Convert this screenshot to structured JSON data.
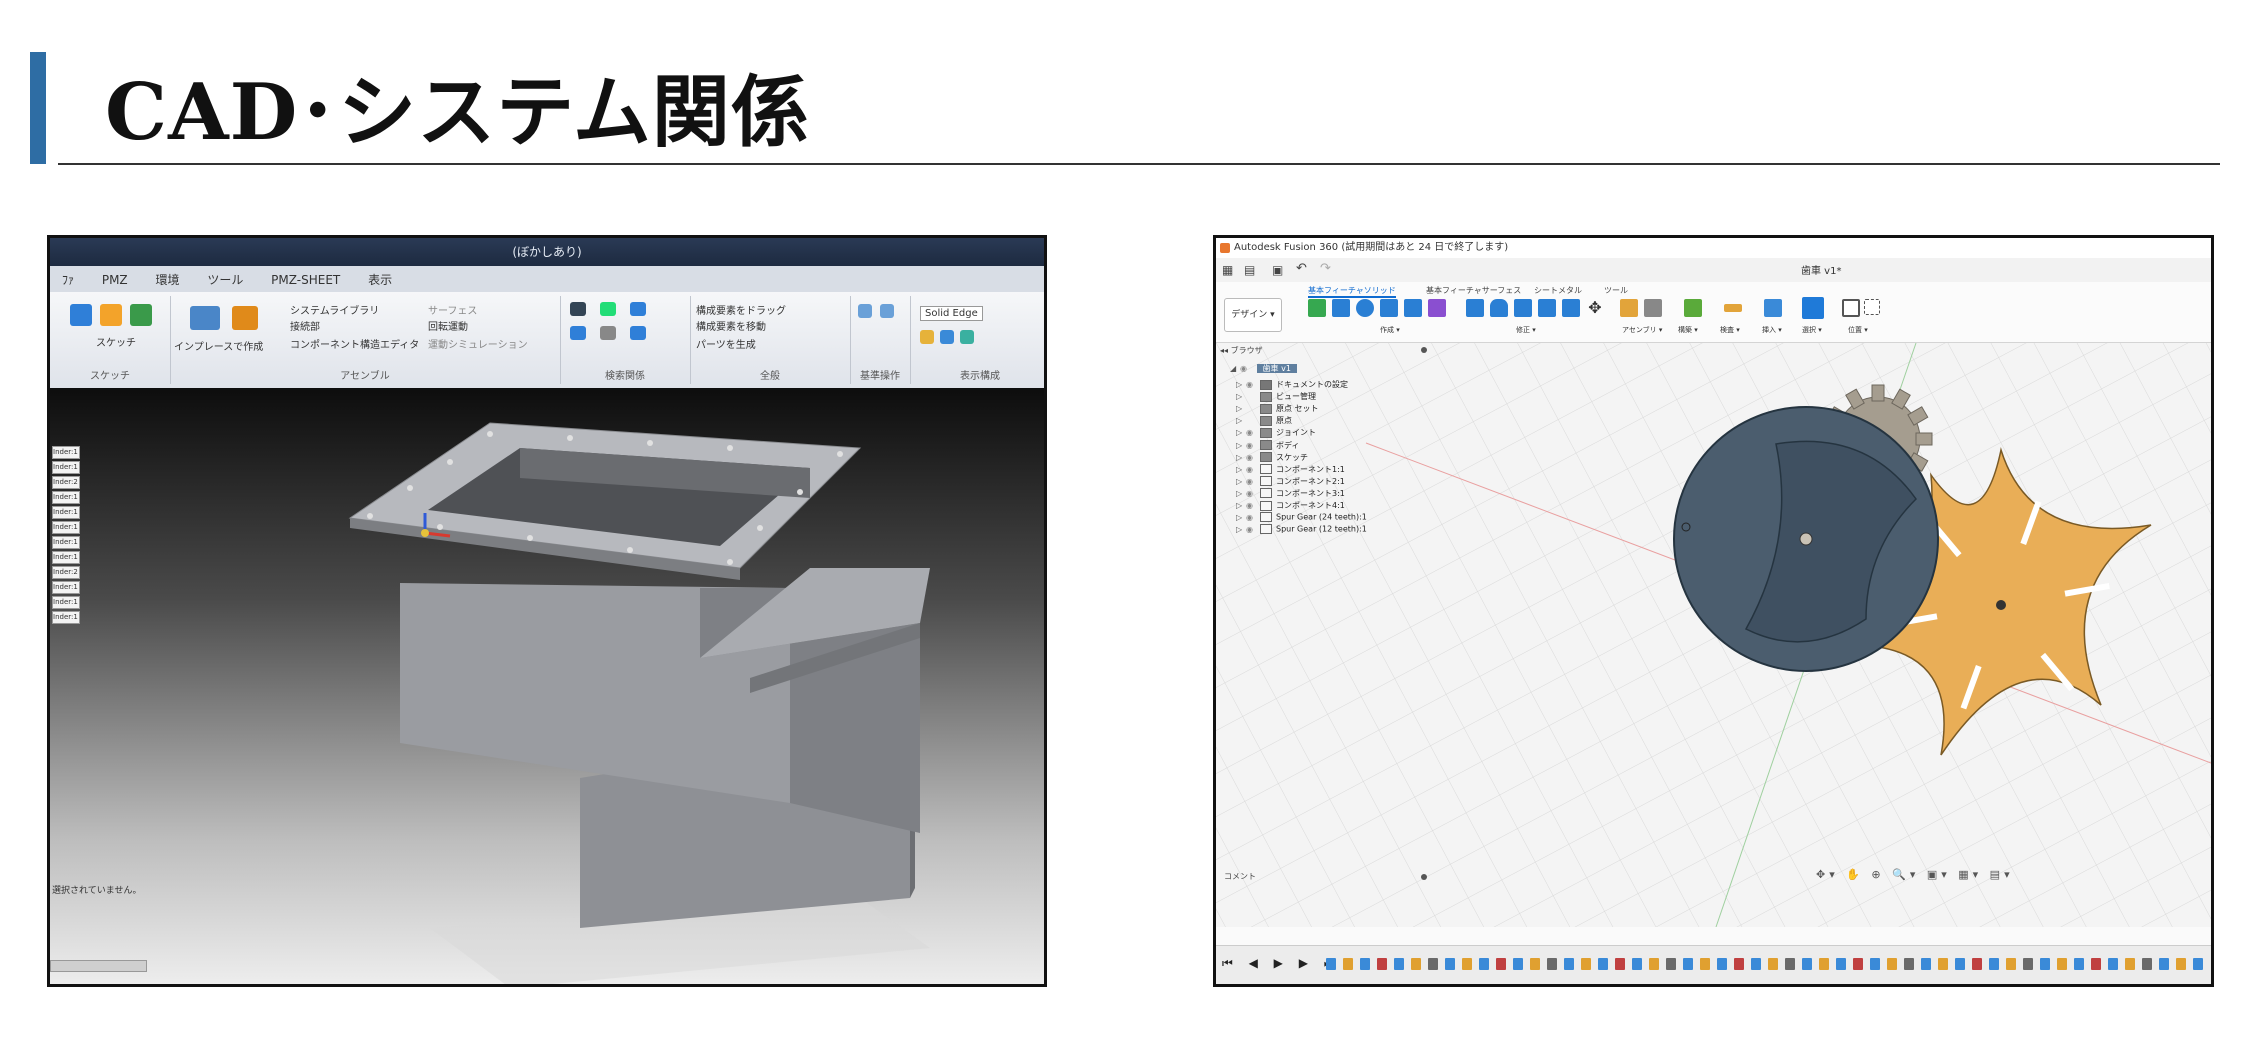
{
  "slide": {
    "title": "CAD･システム関係",
    "accent_color": "#2e6da4"
  },
  "inventor": {
    "window_title": "(ぼかしあり)",
    "tabs": [
      "ﾌｧ",
      "PMZ",
      "環境",
      "ツール",
      "PMZ-SHEET",
      "表示"
    ],
    "groups": [
      "スケッチ",
      "アセンブル",
      "検索関係",
      "全般",
      "基準操作",
      "表示構成"
    ],
    "labels": {
      "sketch": "スケッチ",
      "create_inplace": "インプレースで作成",
      "assemble": "アセンブル",
      "system_library": "システムライブラリ",
      "connect": "接続部",
      "component_editor": "コンポーネント構造エディタ",
      "motion": "回転運動",
      "motion_sim": "運動シミュレーション",
      "surface": "サーフェス",
      "pattern_drag": "構成要素をドラッグ",
      "pattern_move": "構成要素を移動",
      "part_create": "パーツを生成",
      "edge_style": "Solid Edge"
    },
    "browser_items": [
      "Inder:1",
      "Inder:1",
      "Inder:2",
      "Inder:1",
      "Inder:1",
      "Inder:1",
      "Inder:1",
      "Inder:1",
      "Inder:2",
      "Inder:1",
      "Inder:1",
      "Inder:1"
    ],
    "status_text": "選択されていません。",
    "model_color": "#8a8c90"
  },
  "fusion": {
    "window_title": "Autodesk Fusion 360 (試用期間はあと 24 日で終了します)",
    "doc_name": "歯車 v1*",
    "tabs": [
      "ソリッド",
      "サーフェス",
      "シートメタル",
      "ツール"
    ],
    "tab_prefix": "基本フィーチャ",
    "design_button": "デザイン ▾",
    "groups": [
      "作成 ▾",
      "修正 ▾",
      "アセンブリ ▾",
      "構築 ▾",
      "検査 ▾",
      "挿入 ▾",
      "選択 ▾",
      "位置 ▾"
    ],
    "browser_header": "ブラウザ",
    "browser_root": "歯車 v1",
    "browser_items": [
      {
        "label": "ドキュメントの設定",
        "icon": "gear-icon"
      },
      {
        "label": "ビュー管理",
        "icon": "folder-icon"
      },
      {
        "label": "原点 セット",
        "icon": "folder-icon"
      },
      {
        "label": "原点",
        "icon": "folder-icon"
      },
      {
        "label": "ジョイント",
        "icon": "folder-icon"
      },
      {
        "label": "ボディ",
        "icon": "folder-icon"
      },
      {
        "label": "スケッチ",
        "icon": "folder-icon"
      },
      {
        "label": "コンポーネント1:1",
        "icon": "component-icon"
      },
      {
        "label": "コンポーネント2:1",
        "icon": "component-icon"
      },
      {
        "label": "コンポーネント3:1",
        "icon": "component-icon"
      },
      {
        "label": "コンポーネント4:1",
        "icon": "component-icon"
      },
      {
        "label": "Spur Gear (24 teeth):1",
        "icon": "component-icon"
      },
      {
        "label": "Spur Gear (12 teeth):1",
        "icon": "component-icon"
      }
    ],
    "comment_label": "コメント",
    "colors": {
      "disc": "#4b5d6e",
      "star": "#e9ae57",
      "gear": "#a59d8f",
      "accent": "#0f6bd0"
    }
  }
}
